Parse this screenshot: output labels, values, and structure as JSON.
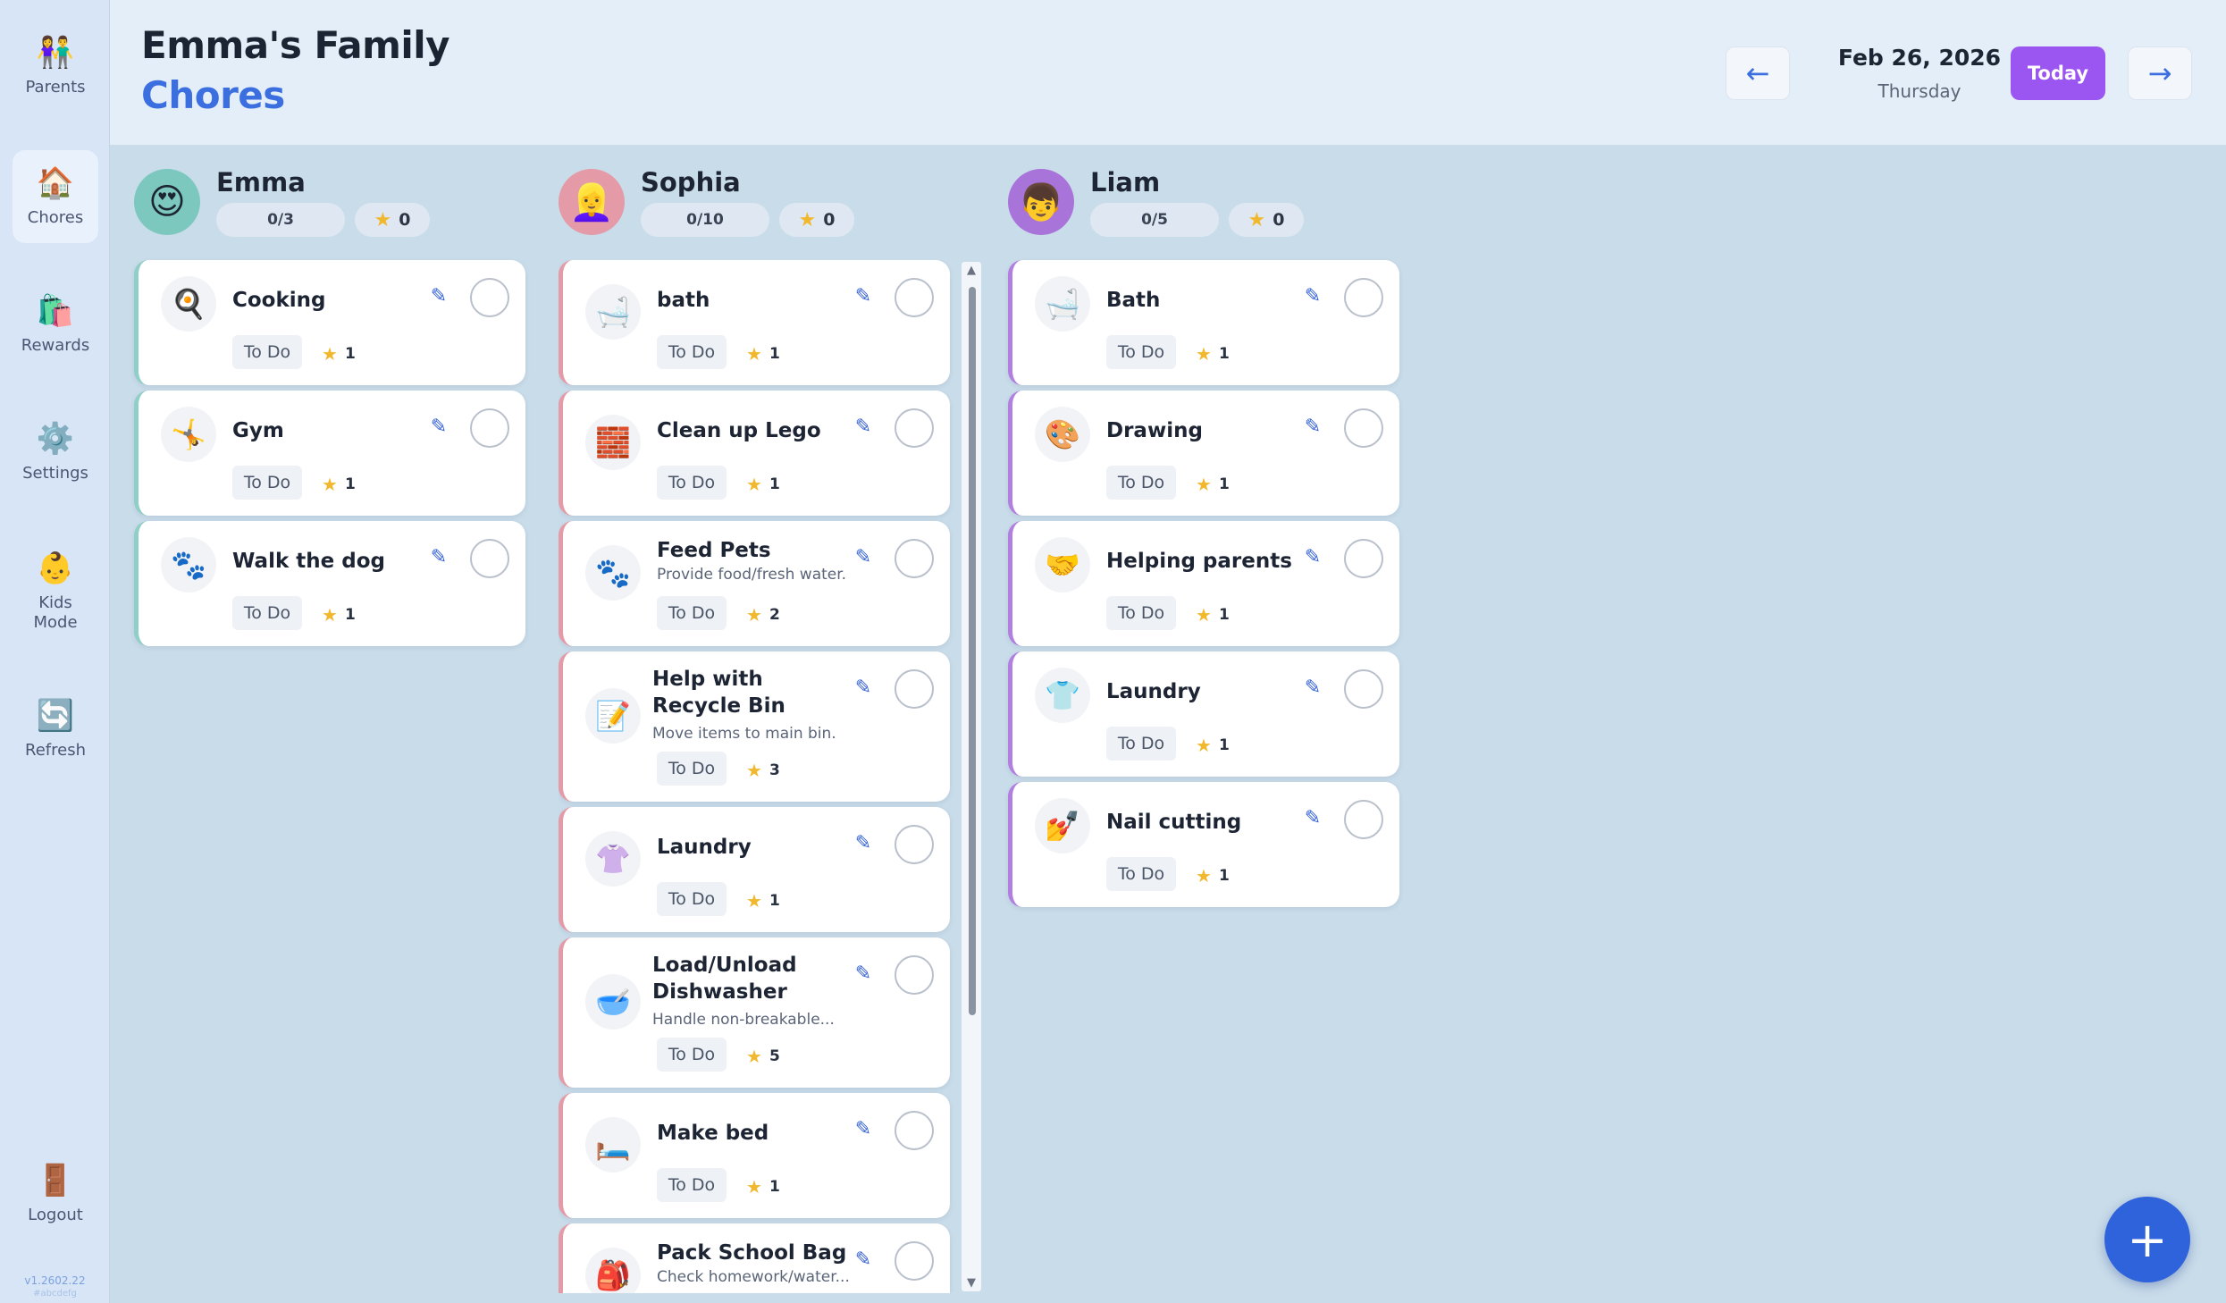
{
  "sidebar": {
    "items": [
      {
        "label": "Parents",
        "icon": "👫",
        "icon_name": "parents-icon"
      },
      {
        "label": "Chores",
        "icon": "🏠",
        "icon_name": "house-icon"
      },
      {
        "label": "Rewards",
        "icon": "🛍️",
        "icon_name": "shopping-bag-icon"
      },
      {
        "label": "Settings",
        "icon": "⚙️",
        "icon_name": "gear-icon"
      },
      {
        "label": "Kids Mode",
        "icon": "👶",
        "icon_name": "baby-icon"
      },
      {
        "label": "Refresh",
        "icon": "🔄",
        "icon_name": "refresh-icon"
      },
      {
        "label": "Logout",
        "icon": "🚪",
        "icon_name": "door-icon"
      }
    ],
    "active": "Chores",
    "version": "v1.2602.22",
    "version_sub": "#abcdefg"
  },
  "header": {
    "family_title": "Emma's Family",
    "page_title": "Chores",
    "date": "Feb 26, 2026",
    "weekday": "Thursday",
    "today_label": "Today",
    "prev_icon": "←",
    "next_icon": "→"
  },
  "status_label": "To Do",
  "colors": {
    "accent": "#3b6fe0",
    "today": "#9b55f0",
    "emma": "#8fcfc7",
    "sophia": "#e59aa7",
    "liam": "#b07fe0",
    "star": "#f1b82d"
  },
  "kids": {
    "emma": {
      "name": "Emma",
      "avatar": "😍",
      "progress": "0/3",
      "stars": "0",
      "chores": [
        {
          "title": "Cooking",
          "desc": "",
          "icon": "🍳",
          "points": "1"
        },
        {
          "title": "Gym",
          "desc": "",
          "icon": "🤸",
          "points": "1"
        },
        {
          "title": "Walk the dog",
          "desc": "",
          "icon": "🐾",
          "points": "1"
        }
      ]
    },
    "sophia": {
      "name": "Sophia",
      "avatar": "👱‍♀️",
      "progress": "0/10",
      "stars": "0",
      "chores": [
        {
          "title": "bath",
          "desc": "",
          "icon": "🛁",
          "points": "1"
        },
        {
          "title": "Clean up Lego",
          "desc": "",
          "icon": "🧱",
          "points": "1"
        },
        {
          "title": "Feed Pets",
          "desc": "Provide food/fresh water.",
          "icon": "🐾",
          "points": "2"
        },
        {
          "title": "Help with Recycle Bin",
          "desc": "Move items to main bin.",
          "icon": "📝",
          "points": "3"
        },
        {
          "title": "Laundry",
          "desc": "",
          "icon": "👚",
          "points": "1"
        },
        {
          "title": "Load/Unload Dishwasher",
          "desc": "Handle non-breakable...",
          "icon": "🥣",
          "points": "5"
        },
        {
          "title": "Make bed",
          "desc": "",
          "icon": "🛏️",
          "points": "1"
        },
        {
          "title": "Pack School Bag",
          "desc": "Check homework/water...",
          "icon": "🎒",
          "points": ""
        }
      ]
    },
    "liam": {
      "name": "Liam",
      "avatar": "👦",
      "progress": "0/5",
      "stars": "0",
      "chores": [
        {
          "title": "Bath",
          "desc": "",
          "icon": "🛁",
          "points": "1"
        },
        {
          "title": "Drawing",
          "desc": "",
          "icon": "🎨",
          "points": "1"
        },
        {
          "title": "Helping parents",
          "desc": "",
          "icon": "🤝",
          "points": "1"
        },
        {
          "title": "Laundry",
          "desc": "",
          "icon": "👕",
          "points": "1"
        },
        {
          "title": "Nail cutting",
          "desc": "",
          "icon": "💅",
          "points": "1"
        }
      ]
    }
  },
  "fab_label": "+"
}
